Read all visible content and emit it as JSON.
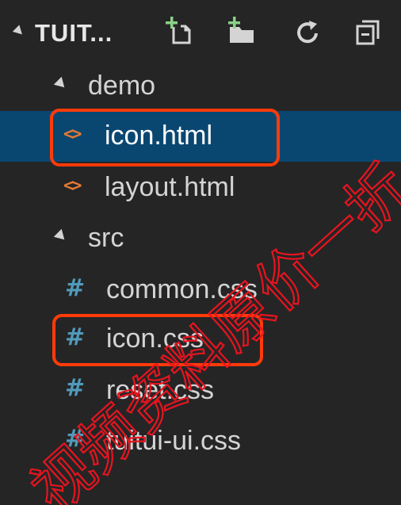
{
  "explorer": {
    "title": "TUIT...",
    "actions": [
      {
        "icon": "new-file-icon"
      },
      {
        "icon": "new-folder-icon"
      },
      {
        "icon": "refresh-icon"
      },
      {
        "icon": "collapse-all-icon"
      }
    ]
  },
  "tree": {
    "demo": {
      "label": "demo",
      "files": [
        {
          "label": "icon.html",
          "icon_glyph": "<>",
          "selected": true,
          "highlighted": true
        },
        {
          "label": "layout.html",
          "icon_glyph": "<>",
          "selected": false,
          "highlighted": false
        }
      ]
    },
    "src": {
      "label": "src",
      "files": [
        {
          "label": "common.css",
          "icon_glyph": "#",
          "highlighted": false
        },
        {
          "label": "icon.css",
          "icon_glyph": "#",
          "highlighted": true
        },
        {
          "label": "reset.css",
          "icon_glyph": "#",
          "highlighted": false
        },
        {
          "label": "tuitui-ui.css",
          "icon_glyph": "#",
          "highlighted": false
        }
      ]
    }
  },
  "colors": {
    "background": "#252526",
    "selection": "#094771",
    "highlight_border": "#ff3b0a",
    "html_icon": "#e37933",
    "css_icon": "#519aba"
  },
  "watermark": "视频资料原价一折"
}
